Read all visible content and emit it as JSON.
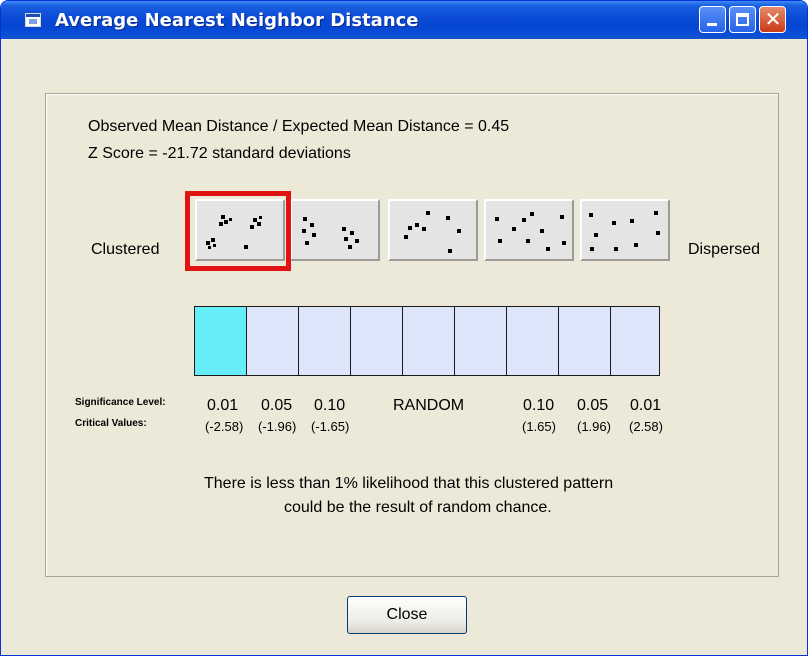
{
  "window": {
    "title": "Average Nearest Neighbor Distance",
    "controls": {
      "minimize_icon": "minimize-icon",
      "maximize_icon": "maximize-icon",
      "close_icon": "close-icon",
      "close_glyph": "✕"
    }
  },
  "summary": {
    "ratio_line": "Observed Mean Distance / Expected Mean Distance = 0.45",
    "zscore_line": "Z Score = -21.72 standard deviations"
  },
  "patterns": {
    "left_label": "Clustered",
    "right_label": "Dispersed",
    "selected_index": 0,
    "count": 5
  },
  "scale": {
    "active_index": 0,
    "cell_count": 9,
    "highlight_color": "#66eef8",
    "cell_color": "#dde5fb",
    "significance_label": "Significance Level:",
    "critical_label": "Critical Values:",
    "left_levels": [
      "0.01",
      "0.05",
      "0.10"
    ],
    "left_critical": [
      "(-2.58)",
      "(-1.96)",
      "(-1.65)"
    ],
    "center_label": "RANDOM",
    "right_levels": [
      "0.10",
      "0.05",
      "0.01"
    ],
    "right_critical": [
      "(1.65)",
      "(1.96)",
      "(2.58)"
    ]
  },
  "message": {
    "line1": "There is less than 1% likelihood that this clustered pattern",
    "line2": "could be the result of random chance."
  },
  "buttons": {
    "close_label": "Close"
  }
}
